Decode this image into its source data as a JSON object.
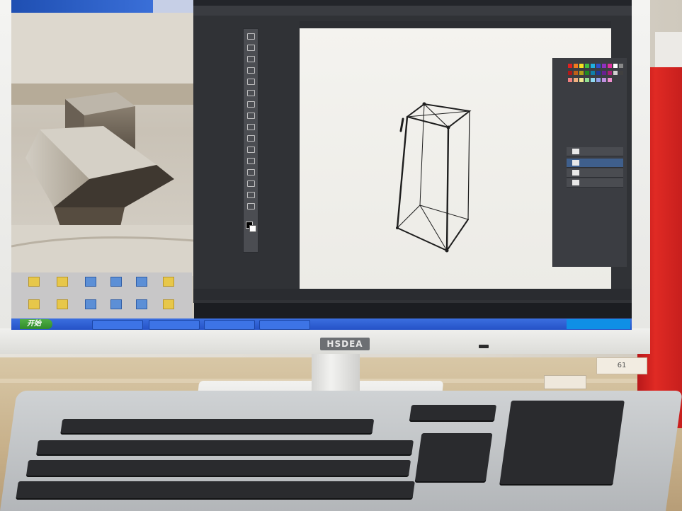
{
  "scene": {
    "monitor_brand": "HSDEA",
    "sticker_text": "61"
  },
  "taskbar": {
    "start_label": "开始"
  },
  "colors": {
    "wall": "#e3e0d8",
    "desk": "#cdb892",
    "bag_red": "#d42320",
    "ps_dark": "#303236",
    "xp_taskbar": "#2e5fd4",
    "xp_start": "#3a9a35"
  },
  "icons": [
    "desktop-folder-icon",
    "desktop-document-icon",
    "ps-tool-icon"
  ]
}
